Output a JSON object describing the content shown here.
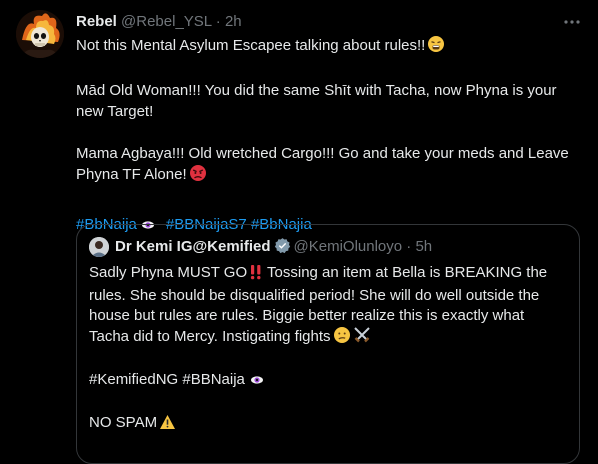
{
  "tweet": {
    "author_name": "Rebel",
    "author_handle": "@Rebel_YSL",
    "separator": "·",
    "time": "2h",
    "line1": "Not this Mental Asylum Escapee talking about rules!!",
    "line2": "Mād Old Woman!!! You did the same Shīt with Tacha, now Phyna is your new Target!",
    "line3": "Mama Agbaya!!! Old wretched Cargo!!! Go and take your meds and Leave Phyna TF Alone!",
    "hashtags": [
      "#BbNaija",
      "#BBNaijaS7",
      "#BbNajia"
    ]
  },
  "quoted": {
    "author_name": "Dr Kemi IG@Kemified",
    "author_handle": "@KemiOlunloyo",
    "separator": "·",
    "time": "5h",
    "line1a": "Sadly Phyna MUST GO",
    "line1b": " Tossing an item at Bella is BREAKING the rules. She should be disqualified period! She will do well outside the house but rules are rules. Biggie better realize this is exactly what Tacha did to Mercy. Instigating fights",
    "hashtags": "#KemifiedNG #BBNaija",
    "line3": "NO SPAM"
  },
  "icons": [
    "more-icon",
    "verified-icon",
    "eye-hashtag-icon",
    "weary-face-emoji",
    "angry-face-emoji",
    "double-exclamation-emoji",
    "confused-face-emoji",
    "crossed-swords-emoji",
    "warning-emoji"
  ],
  "colors": {
    "background": "#000000",
    "text": "#e7e9ea",
    "muted": "#71767b",
    "link": "#1d9bf0",
    "border": "#333639",
    "verified": "#829aab"
  }
}
